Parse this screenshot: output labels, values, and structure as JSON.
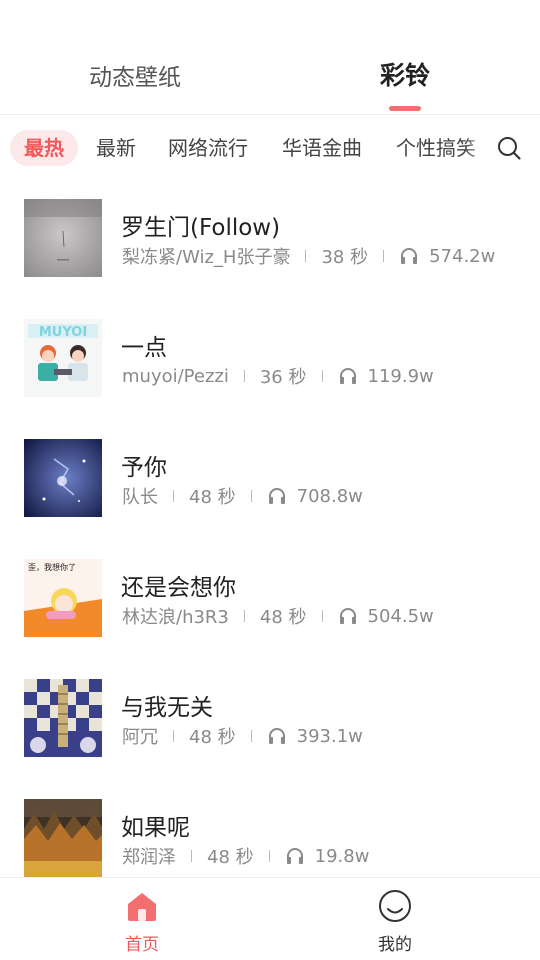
{
  "top_tabs": [
    {
      "label": "动态壁纸",
      "active": false
    },
    {
      "label": "彩铃",
      "active": true
    }
  ],
  "categories": [
    "最热",
    "最新",
    "网络流行",
    "华语金曲",
    "个性搞笑"
  ],
  "active_category": "最热",
  "search_icon": "search-icon",
  "songs": [
    {
      "title": "罗生门(Follow)",
      "artist": "梨冻紧/Wiz_H张子豪",
      "duration": "38 秒",
      "plays": "574.2w"
    },
    {
      "title": "一点",
      "artist": "muyoi/Pezzi",
      "duration": "36 秒",
      "plays": "119.9w"
    },
    {
      "title": "予你",
      "artist": "队长",
      "duration": "48 秒",
      "plays": "708.8w"
    },
    {
      "title": "还是会想你",
      "artist": "林达浪/h3R3",
      "duration": "48 秒",
      "plays": "504.5w"
    },
    {
      "title": "与我无关",
      "artist": "阿冗",
      "duration": "48 秒",
      "plays": "393.1w"
    },
    {
      "title": "如果呢",
      "artist": "郑润泽",
      "duration": "48 秒",
      "plays": "19.8w"
    }
  ],
  "cover_texts": {
    "cover2_brand": "MUYOI",
    "cover4_caption": "歪，我想你了"
  },
  "bottom_nav": [
    {
      "label": "首页",
      "icon": "home-icon",
      "active": true
    },
    {
      "label": "我的",
      "icon": "profile-icon",
      "active": false
    }
  ],
  "colors": {
    "accent": "#f05a5a",
    "accent_bg": "#fde8ea",
    "underline": "#f36f6f",
    "meta_text": "#8a8a8a"
  }
}
